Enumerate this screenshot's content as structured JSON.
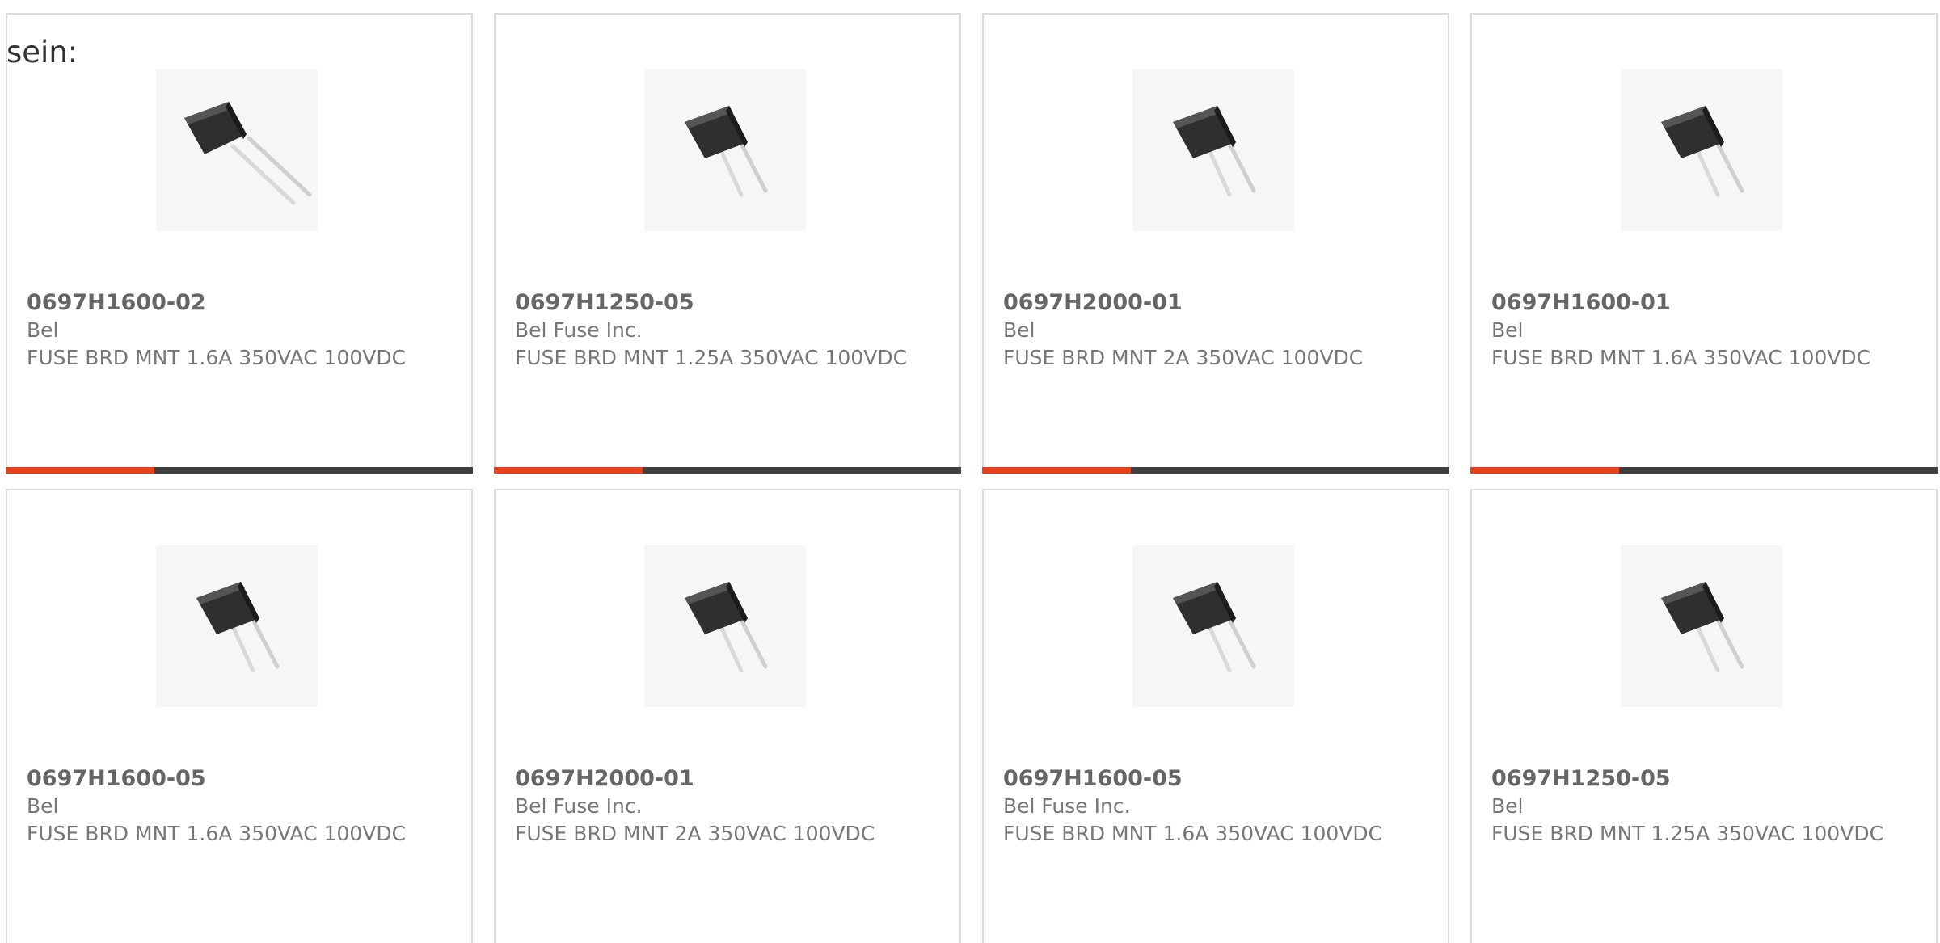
{
  "lead_text": "sein:",
  "cards": [
    {
      "part_number": "0697H1600-02",
      "manufacturer": "Bel",
      "description": "FUSE BRD MNT 1.6A 350VAC 100VDC"
    },
    {
      "part_number": "0697H1250-05",
      "manufacturer": "Bel Fuse Inc.",
      "description": "FUSE BRD MNT 1.25A 350VAC 100VDC"
    },
    {
      "part_number": "0697H2000-01",
      "manufacturer": "Bel",
      "description": "FUSE BRD MNT 2A 350VAC 100VDC"
    },
    {
      "part_number": "0697H1600-01",
      "manufacturer": "Bel",
      "description": "FUSE BRD MNT 1.6A 350VAC 100VDC"
    },
    {
      "part_number": "0697H1600-05",
      "manufacturer": "Bel",
      "description": "FUSE BRD MNT 1.6A 350VAC 100VDC"
    },
    {
      "part_number": "0697H2000-01",
      "manufacturer": "Bel Fuse Inc.",
      "description": "FUSE BRD MNT 2A 350VAC 100VDC"
    },
    {
      "part_number": "0697H1600-05",
      "manufacturer": "Bel Fuse Inc.",
      "description": "FUSE BRD MNT 1.6A 350VAC 100VDC"
    },
    {
      "part_number": "0697H1250-05",
      "manufacturer": "Bel",
      "description": "FUSE BRD MNT 1.25A 350VAC 100VDC"
    }
  ],
  "colors": {
    "accent": "#e8401c",
    "bar": "#3f3f3f",
    "card_border": "#dcdcdc",
    "text_muted": "#777777"
  },
  "icons": {
    "product_image": "fuse-component-image"
  }
}
